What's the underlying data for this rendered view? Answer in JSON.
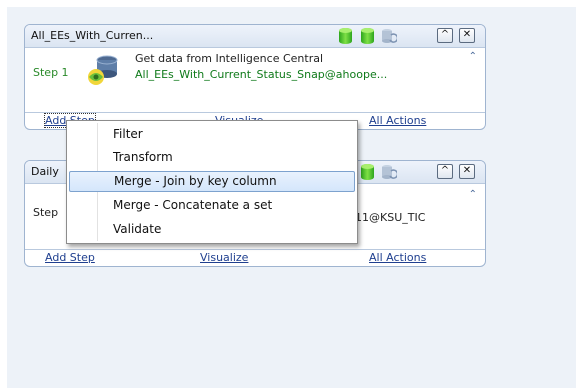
{
  "panels": [
    {
      "title": "All_EEs_With_Curren...",
      "step_label": "Step 1",
      "step_line1": "Get data from Intelligence Central",
      "step_line2": "All_EEs_With_Current_Status_Snap@ahoope...",
      "collapse_glyph": "⌃",
      "minimize_glyph": "^",
      "close_glyph": "✕",
      "footer": {
        "add_step": "Add Step",
        "visualize": "Visualize",
        "all_actions": "All Actions"
      }
    },
    {
      "title": "Daily",
      "step_label": "Step",
      "step_line2": "11@KSU_TIC",
      "collapse_glyph": "⌃",
      "minimize_glyph": "^",
      "close_glyph": "✕",
      "footer": {
        "add_step": "Add Step",
        "visualize": "Visualize",
        "all_actions": "All Actions"
      }
    }
  ],
  "icons": {
    "database": "database-icon",
    "sync": "database-sync-icon",
    "step": "intelligence-central-icon"
  },
  "colors": {
    "step_green": "#2a8a2a",
    "link_blue": "#1f3f8f",
    "menu_highlight": "#d4e6fb",
    "panel_border": "#9fb4d0"
  },
  "context_menu": {
    "items": [
      "Filter",
      "Transform",
      "Merge - Join by key column",
      "Merge - Concatenate a set",
      "Validate"
    ],
    "highlighted_index": 2
  }
}
